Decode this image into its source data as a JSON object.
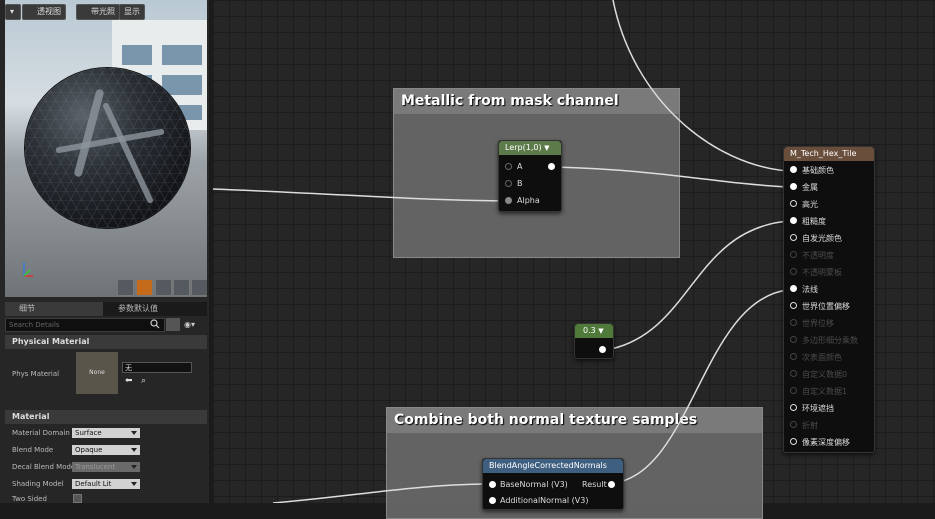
{
  "viewport_toolbar": {
    "dropdown": "▾",
    "perspective": "透视图",
    "lit": "带光照",
    "show": "显示"
  },
  "details": {
    "tab_details": "细节",
    "tab_params": "参数默认值",
    "search_placeholder": "Search Details",
    "physical_material": {
      "header": "Physical Material",
      "phys_material_label": "Phys Material",
      "thumb_label": "None",
      "combo_value": "无"
    },
    "material": {
      "header": "Material",
      "rows": [
        {
          "label": "Material Domain",
          "value": "Surface",
          "disabled": false
        },
        {
          "label": "Blend Mode",
          "value": "Opaque",
          "disabled": false
        },
        {
          "label": "Decal Blend Mode",
          "value": "Translucent",
          "disabled": true
        },
        {
          "label": "Shading Model",
          "value": "Default Lit",
          "disabled": false
        },
        {
          "label": "Two Sided",
          "value": "",
          "disabled": false
        }
      ]
    }
  },
  "graph": {
    "comment_metallic": "Metallic from mask channel",
    "comment_normals": "Combine both normal texture samples",
    "lerp": {
      "title": "Lerp(1,0)",
      "pins": [
        "A",
        "B",
        "Alpha"
      ]
    },
    "const_node": {
      "value": "0.3"
    },
    "blend": {
      "title": "BlendAngleCorrectedNormals",
      "base": "BaseNormal (V3)",
      "additional": "AdditionalNormal (V3)",
      "result": "Result"
    },
    "material_node": {
      "title": "M_Tech_Hex_Tile",
      "pins": [
        {
          "label": "基础颜色",
          "active": true,
          "connected": true
        },
        {
          "label": "金属",
          "active": true,
          "connected": true
        },
        {
          "label": "高光",
          "active": true,
          "connected": false
        },
        {
          "label": "粗糙度",
          "active": true,
          "connected": true
        },
        {
          "label": "自发光颜色",
          "active": true,
          "connected": false
        },
        {
          "label": "不透明度",
          "active": false,
          "connected": false
        },
        {
          "label": "不透明蒙板",
          "active": false,
          "connected": false
        },
        {
          "label": "法线",
          "active": true,
          "connected": true
        },
        {
          "label": "世界位置偏移",
          "active": true,
          "connected": false
        },
        {
          "label": "世界位移",
          "active": false,
          "connected": false
        },
        {
          "label": "多边形细分乘数",
          "active": false,
          "connected": false
        },
        {
          "label": "次表面颜色",
          "active": false,
          "connected": false
        },
        {
          "label": "自定义数据0",
          "active": false,
          "connected": false
        },
        {
          "label": "自定义数据1",
          "active": false,
          "connected": false
        },
        {
          "label": "环境遮挡",
          "active": true,
          "connected": false
        },
        {
          "label": "折射",
          "active": false,
          "connected": false
        },
        {
          "label": "像素深度偏移",
          "active": true,
          "connected": false
        }
      ]
    }
  },
  "colors": {
    "lerp_header": "#5c7a4a",
    "const_header": "#4f7a3a",
    "blend_header": "#3f5f80",
    "material_header": "#6a4e3c",
    "accent_orange": "#c56a1a"
  }
}
